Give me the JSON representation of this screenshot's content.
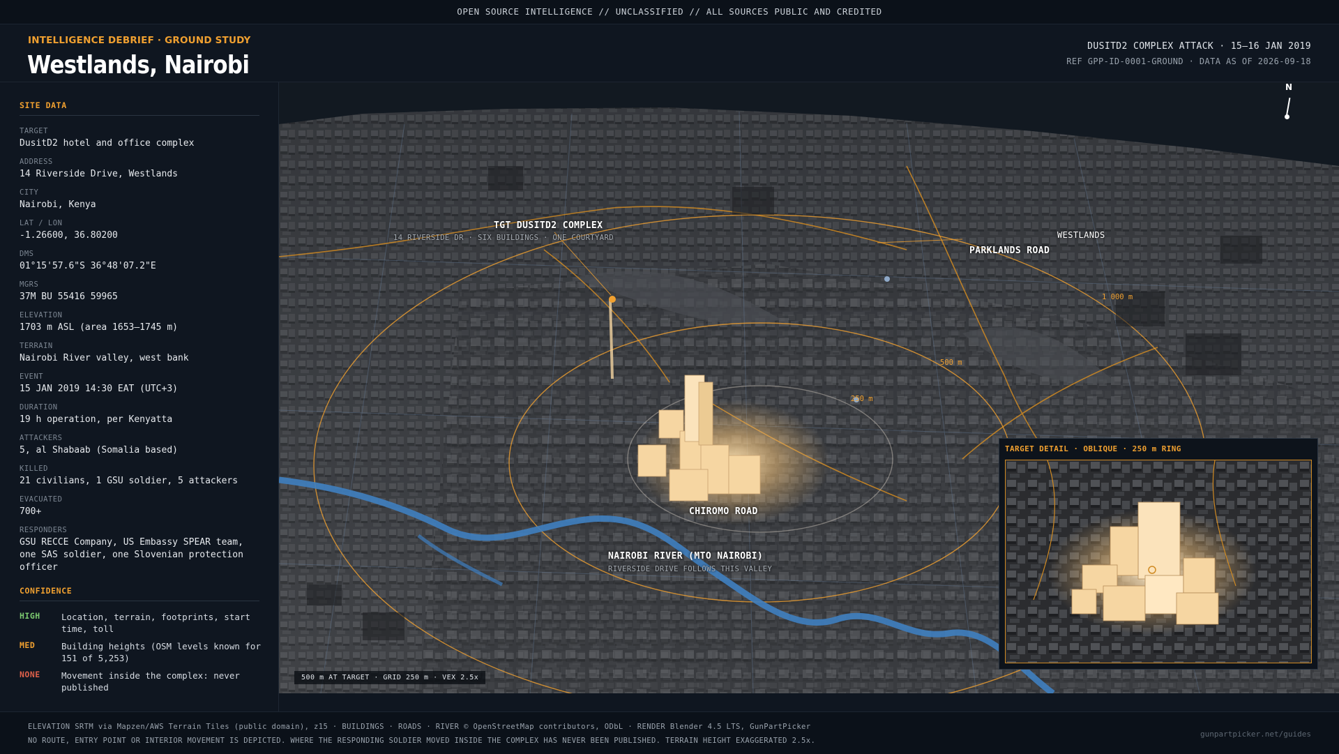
{
  "topbar": {
    "text": "OPEN SOURCE INTELLIGENCE  //  UNCLASSIFIED  //  ALL SOURCES PUBLIC AND CREDITED"
  },
  "header": {
    "kicker": "INTELLIGENCE DEBRIEF · GROUND STUDY",
    "title": "Westlands, Nairobi",
    "event_line": "DUSITD2 COMPLEX ATTACK  ·  15–16 JAN 2019",
    "ref_line": "REF  GPP-ID-0001-GROUND   ·   DATA AS OF 2026-09-18"
  },
  "site_data": {
    "title": "SITE DATA",
    "fields": [
      {
        "label": "TARGET",
        "value": "DusitD2 hotel and office complex"
      },
      {
        "label": "ADDRESS",
        "value": "14 Riverside Drive, Westlands"
      },
      {
        "label": "CITY",
        "value": "Nairobi, Kenya"
      },
      {
        "label": "LAT / LON",
        "value": "-1.26600, 36.80200"
      },
      {
        "label": "DMS",
        "value": "01°15'57.6\"S 36°48'07.2\"E"
      },
      {
        "label": "MGRS",
        "value": "37M BU 55416 59965"
      },
      {
        "label": "ELEVATION",
        "value": "1703 m ASL (area 1653–1745 m)"
      },
      {
        "label": "TERRAIN",
        "value": "Nairobi River valley, west bank"
      },
      {
        "label": "EVENT",
        "value": "15 JAN 2019 14:30 EAT (UTC+3)"
      },
      {
        "label": "DURATION",
        "value": "19 h operation, per Kenyatta"
      },
      {
        "label": "ATTACKERS",
        "value": "5, al Shabaab (Somalia based)"
      },
      {
        "label": "KILLED",
        "value": "21 civilians, 1 GSU soldier, 5 attackers"
      },
      {
        "label": "EVACUATED",
        "value": "700+"
      },
      {
        "label": "RESPONDERS",
        "value": "GSU RECCE Company, US Embassy SPEAR team, one SAS soldier, one Slovenian protection officer"
      }
    ]
  },
  "confidence": {
    "title": "CONFIDENCE",
    "rows": [
      {
        "level": "HIGH",
        "color": "#7bc96f",
        "text": "Location, terrain, footprints, start time, toll"
      },
      {
        "level": "MED",
        "color": "#f0a030",
        "text": "Building heights (OSM levels known for 151 of 5,253)"
      },
      {
        "level": "NONE",
        "color": "#e0604a",
        "text": "Movement inside the complex: never published"
      }
    ]
  },
  "map": {
    "north": "N",
    "target_label": "TGT  DUSITD2 COMPLEX",
    "target_sub": "14 RIVERSIDE DR · SIX BUILDINGS · ONE COURTYARD",
    "westlands": "WESTLANDS",
    "parklands": "PARKLANDS ROAD",
    "chiromo": "CHIROMO ROAD",
    "river_label": "NAIROBI RIVER  (MTO NAIROBI)",
    "river_sub": "RIVERSIDE DRIVE FOLLOWS THIS VALLEY",
    "ring_1000": "1 000 m",
    "ring_500": "500 m",
    "ring_250": "250 m",
    "scale_text": "500 m AT TARGET  ·  GRID 250 m  ·  VEX 2.5x",
    "colors": {
      "ring": "#f0a030",
      "river": "#3f7fc0",
      "target_glow": "#ffdca0"
    }
  },
  "inset": {
    "title": "TARGET DETAIL  ·  OBLIQUE  ·  250 m RING"
  },
  "footer": {
    "line1": "ELEVATION  SRTM via Mapzen/AWS Terrain Tiles (public domain), z15   ·   BUILDINGS · ROADS · RIVER  © OpenStreetMap contributors, ODbL   ·   RENDER  Blender 4.5 LTS, GunPartPicker",
    "line2": "NO ROUTE, ENTRY POINT OR INTERIOR MOVEMENT IS DEPICTED. WHERE THE RESPONDING SOLDIER MOVED INSIDE THE COMPLEX HAS NEVER BEEN PUBLISHED. TERRAIN HEIGHT EXAGGERATED 2.5x.",
    "link": "gunpartpicker.net/guides"
  }
}
